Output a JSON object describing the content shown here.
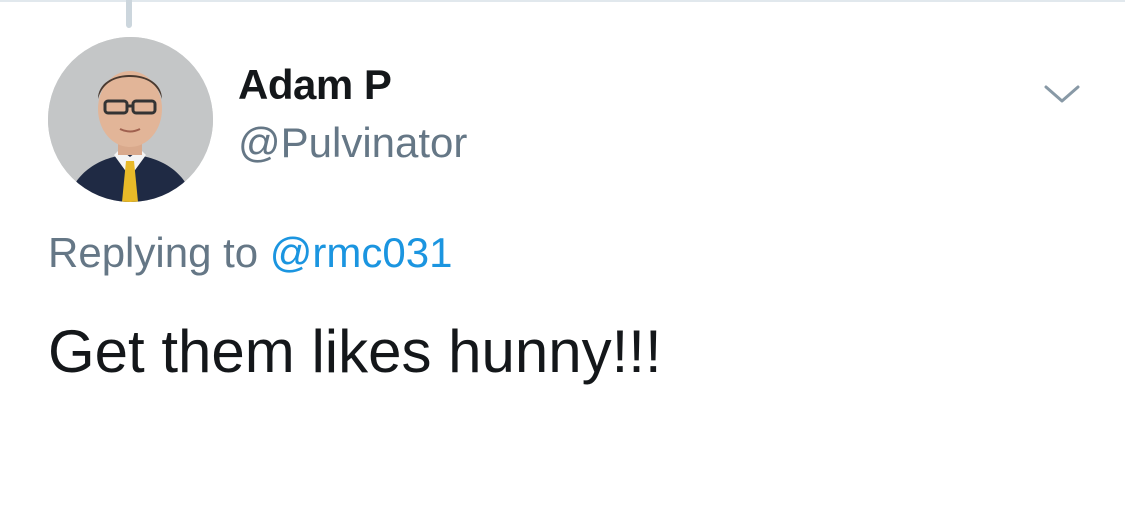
{
  "tweet": {
    "author": {
      "display_name": "Adam P",
      "handle": "@Pulvinator",
      "avatar_icon": "profile-photo"
    },
    "reply": {
      "prefix": "Replying to ",
      "mention": "@rmc031"
    },
    "text": "Get them likes hunny!!!",
    "menu_icon": "chevron-down-icon"
  },
  "colors": {
    "text_primary": "#14171a",
    "text_secondary": "#657786",
    "link": "#1b95e0",
    "thread_line": "#ccd6dd"
  }
}
